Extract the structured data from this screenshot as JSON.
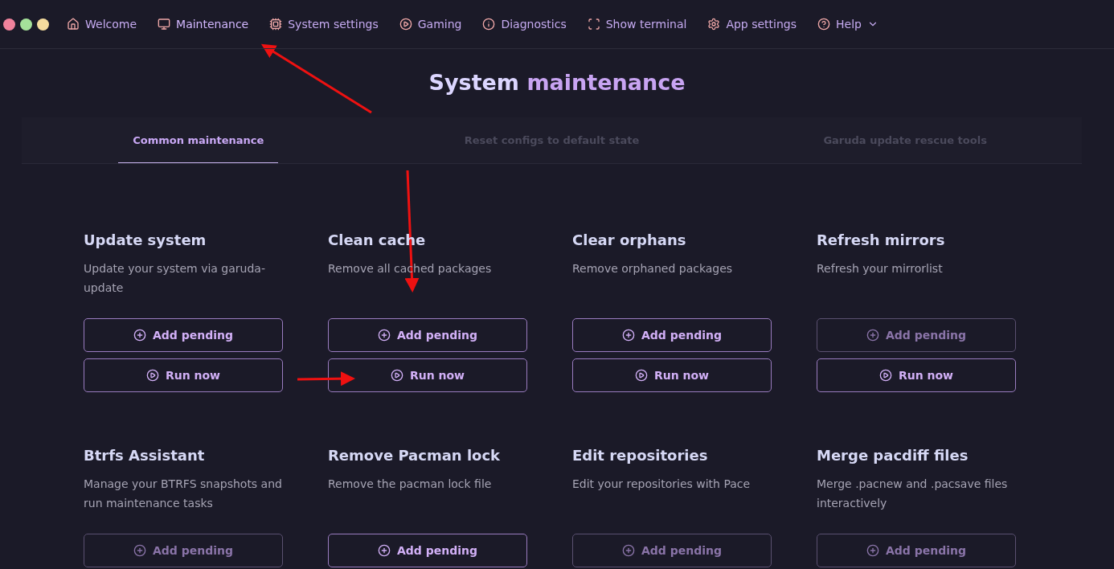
{
  "nav": {
    "items": [
      {
        "kind": "home",
        "label": "Welcome",
        "selected": false
      },
      {
        "kind": "monitor",
        "label": "Maintenance",
        "selected": true
      },
      {
        "kind": "chip",
        "label": "System settings",
        "selected": false
      },
      {
        "kind": "play",
        "label": "Gaming",
        "selected": false
      },
      {
        "kind": "info",
        "label": "Diagnostics",
        "selected": false
      },
      {
        "kind": "frame",
        "label": "Show terminal",
        "selected": false
      },
      {
        "kind": "gear",
        "label": "App settings",
        "selected": false
      },
      {
        "kind": "help",
        "label": "Help",
        "selected": false,
        "dropdown": true
      }
    ]
  },
  "title": {
    "lead": "System",
    "accent": "maintenance"
  },
  "tabs": [
    {
      "label": "Common maintenance",
      "selected": true
    },
    {
      "label": "Reset configs to default state",
      "selected": false
    },
    {
      "label": "Garuda update rescue tools",
      "selected": false
    }
  ],
  "cards": [
    {
      "title": "Update system",
      "description": "Update your system via garuda-update",
      "add": {
        "label": "Add pending",
        "disabled": false
      },
      "run": {
        "label": "Run now"
      }
    },
    {
      "title": "Clean cache",
      "description": "Remove all cached packages",
      "add": {
        "label": "Add pending",
        "disabled": false
      },
      "run": {
        "label": "Run now"
      }
    },
    {
      "title": "Clear orphans",
      "description": "Remove orphaned packages",
      "add": {
        "label": "Add pending",
        "disabled": false
      },
      "run": {
        "label": "Run now"
      }
    },
    {
      "title": "Refresh mirrors",
      "description": "Refresh your mirrorlist",
      "add": {
        "label": "Add pending",
        "disabled": true
      },
      "run": {
        "label": "Run now"
      }
    },
    {
      "title": "Btrfs Assistant",
      "description": "Manage your BTRFS snapshots and run maintenance tasks",
      "add": {
        "label": "Add pending",
        "disabled": true
      }
    },
    {
      "title": "Remove Pacman lock",
      "description": "Remove the pacman lock file",
      "add": {
        "label": "Add pending",
        "disabled": false
      }
    },
    {
      "title": "Edit repositories",
      "description": "Edit your repositories with Pace",
      "add": {
        "label": "Add pending",
        "disabled": true
      }
    },
    {
      "title": "Merge pacdiff files",
      "description": "Merge .pacnew and .pacsave files interactively",
      "add": {
        "label": "Add pending",
        "disabled": true
      }
    }
  ]
}
